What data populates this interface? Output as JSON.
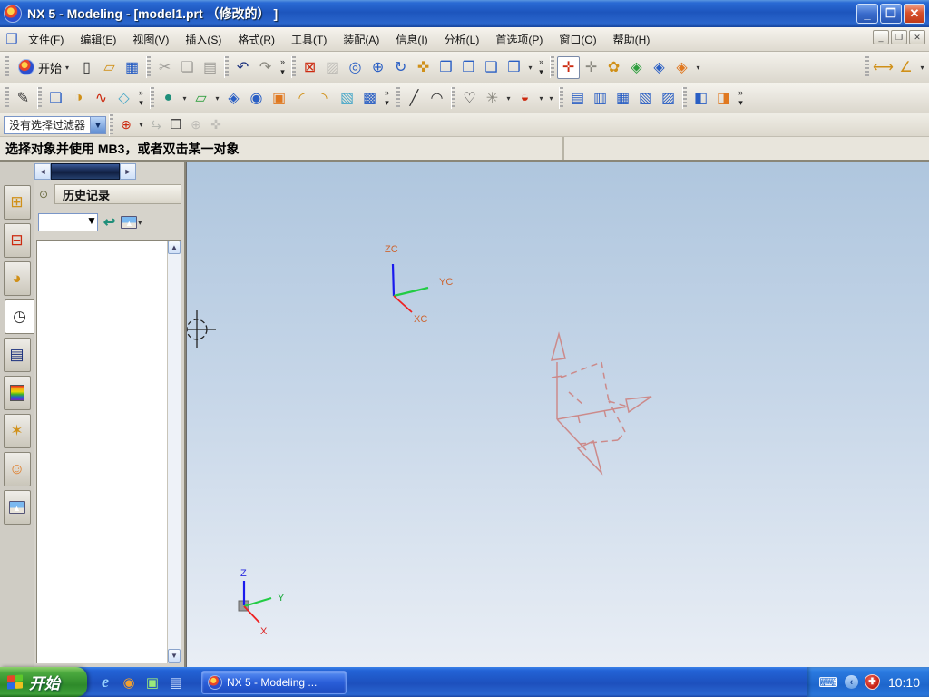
{
  "window": {
    "title": "NX 5 - Modeling - [model1.prt （修改的） ]",
    "minimize": "_",
    "restore": "❐",
    "close": "✕"
  },
  "menubar": {
    "items": [
      {
        "name": "menu-file",
        "label": "文件(F)"
      },
      {
        "name": "menu-edit",
        "label": "编辑(E)"
      },
      {
        "name": "menu-view",
        "label": "视图(V)"
      },
      {
        "name": "menu-insert",
        "label": "插入(S)"
      },
      {
        "name": "menu-format",
        "label": "格式(R)"
      },
      {
        "name": "menu-tools",
        "label": "工具(T)"
      },
      {
        "name": "menu-assemblies",
        "label": "装配(A)"
      },
      {
        "name": "menu-information",
        "label": "信息(I)"
      },
      {
        "name": "menu-analysis",
        "label": "分析(L)"
      },
      {
        "name": "menu-preferences",
        "label": "首选项(P)"
      },
      {
        "name": "menu-window",
        "label": "窗口(O)"
      },
      {
        "name": "menu-help",
        "label": "帮助(H)"
      }
    ],
    "minimize": "_",
    "restore": "❐",
    "close": "✕"
  },
  "toolbars": {
    "start_label": "开始",
    "start_caret": "▾",
    "row1_file": [
      {
        "name": "new-file-button",
        "glyph": "▯",
        "cls": "i-dark"
      },
      {
        "name": "open-file-button",
        "glyph": "▱",
        "cls": "i-gold"
      },
      {
        "name": "save-button",
        "glyph": "▦",
        "cls": "i-blue"
      }
    ],
    "row1_edit": [
      {
        "name": "cut-button",
        "glyph": "✂",
        "cls": "i-dark disabled"
      },
      {
        "name": "copy-button",
        "glyph": "❏",
        "cls": "i-dark disabled"
      },
      {
        "name": "paste-button",
        "glyph": "▤",
        "cls": "i-dark disabled"
      }
    ],
    "row1_hist": [
      {
        "name": "undo-button",
        "glyph": "↶",
        "cls": "i-dblue"
      },
      {
        "name": "redo-button",
        "glyph": "↷",
        "cls": "i-gray"
      },
      {
        "name": "toolbar-overflow",
        "glyph": "»\n▾",
        "cls": "overflow"
      }
    ],
    "row1_view": [
      {
        "name": "fit-view-button",
        "glyph": "⊠",
        "cls": "i-red"
      },
      {
        "name": "trim-view-button",
        "glyph": "▨",
        "cls": "i-gray disabled"
      },
      {
        "name": "zoom-box-button",
        "glyph": "◎",
        "cls": "i-blue"
      },
      {
        "name": "zoom-in-out-button",
        "glyph": "⊕",
        "cls": "i-blue"
      },
      {
        "name": "rotate-view-button",
        "glyph": "↻",
        "cls": "i-blue"
      },
      {
        "name": "pan-view-button",
        "glyph": "✜",
        "cls": "i-gold"
      },
      {
        "name": "perspective-button",
        "glyph": "❒",
        "cls": "i-blue"
      }
    ],
    "row1_assembly": [
      {
        "name": "assembly-constraints-button",
        "glyph": "❐",
        "cls": "i-blue"
      },
      {
        "name": "move-component-button",
        "glyph": "❑",
        "cls": "i-blue"
      }
    ],
    "row1_display": [
      {
        "name": "shaded-display-button",
        "glyph": "❒",
        "cls": "i-blue"
      },
      {
        "name": "display-dropdown-caret",
        "glyph": "▾",
        "cls": "caret"
      },
      {
        "name": "toolbar-overflow",
        "glyph": "»\n▾",
        "cls": "overflow"
      }
    ],
    "row1_wcs": [
      {
        "name": "wcs-dynamics-button",
        "glyph": "✛",
        "cls": "i-red pressed"
      },
      {
        "name": "wcs-origin-button",
        "glyph": "✛",
        "cls": "i-gray"
      },
      {
        "name": "object-display-button",
        "glyph": "✿",
        "cls": "i-gold"
      },
      {
        "name": "show-hide-button",
        "glyph": "◈",
        "cls": "i-green"
      },
      {
        "name": "invert-shown-button",
        "glyph": "◈",
        "cls": "i-blue"
      },
      {
        "name": "edit-display-button",
        "glyph": "◈",
        "cls": "i-orange"
      },
      {
        "name": "visibility-dropdown-caret",
        "glyph": "▾",
        "cls": "caret"
      }
    ],
    "row1_measure": [
      {
        "name": "measure-distance-button",
        "glyph": "⟷",
        "cls": "i-gold"
      },
      {
        "name": "measure-angle-button",
        "glyph": "∠",
        "cls": "i-gold"
      },
      {
        "name": "measure-dropdown-caret",
        "glyph": "▾",
        "cls": "caret"
      }
    ],
    "row2_sketch_task": [
      {
        "name": "sketch-in-task-button",
        "glyph": "✎",
        "cls": "i-dark"
      }
    ],
    "row2_solids": [
      {
        "name": "extrude-button",
        "glyph": "❏",
        "cls": "i-blue"
      },
      {
        "name": "revolve-button",
        "glyph": "◑",
        "cls": "i-gold"
      },
      {
        "name": "sweep-button",
        "glyph": "∿",
        "cls": "i-red"
      },
      {
        "name": "sheet-body-button",
        "glyph": "◇",
        "cls": "i-cyan"
      },
      {
        "name": "toolbar-overflow",
        "glyph": "»\n▾",
        "cls": "overflow"
      }
    ],
    "row2_sketch": [
      {
        "name": "sketch-button",
        "glyph": "●",
        "cls": "i-teal"
      },
      {
        "name": "sketch-dropdown-caret",
        "glyph": "▾",
        "cls": "caret"
      },
      {
        "name": "datum-plane-button",
        "glyph": "▱",
        "cls": "i-green"
      },
      {
        "name": "datum-plane-dropdown-caret",
        "glyph": "▾",
        "cls": "caret"
      }
    ],
    "row2_datum": [
      {
        "name": "datum-csys-button",
        "glyph": "◈",
        "cls": "i-blue"
      },
      {
        "name": "bounded-plane-button",
        "glyph": "◉",
        "cls": "i-blue"
      }
    ],
    "row2_features": [
      {
        "name": "block-button",
        "glyph": "▣",
        "cls": "i-orange"
      },
      {
        "name": "bend-button",
        "glyph": "◜",
        "cls": "i-gold"
      },
      {
        "name": "flange-button",
        "glyph": "◝",
        "cls": "i-gold"
      },
      {
        "name": "shell-button",
        "glyph": "▧",
        "cls": "i-cyan"
      },
      {
        "name": "boss-button",
        "glyph": "▩",
        "cls": "i-blue"
      },
      {
        "name": "toolbar-overflow",
        "glyph": "»\n▾",
        "cls": "overflow"
      }
    ],
    "row2_curves": [
      {
        "name": "line-button",
        "glyph": "╱",
        "cls": "i-dark"
      },
      {
        "name": "arc-button",
        "glyph": "◠",
        "cls": "i-dark"
      }
    ],
    "row2_profile": [
      {
        "name": "profile-curve-button",
        "glyph": "♡",
        "cls": "i-dark"
      },
      {
        "name": "point-set-button",
        "glyph": "✳",
        "cls": "i-gray"
      },
      {
        "name": "point-dropdown-caret",
        "glyph": "▾",
        "cls": "caret"
      },
      {
        "name": "offset-surface-button",
        "glyph": "◒",
        "cls": "i-red"
      },
      {
        "name": "surface-dropdown-caret",
        "glyph": "▾",
        "cls": "caret"
      },
      {
        "name": "toolbar-options-caret",
        "glyph": "▾",
        "cls": "caret"
      }
    ],
    "row2_mesh": [
      {
        "name": "ruled-surface-button",
        "glyph": "▤",
        "cls": "i-blue"
      },
      {
        "name": "through-curves-button",
        "glyph": "▥",
        "cls": "i-blue"
      },
      {
        "name": "through-curve-mesh-button",
        "glyph": "▦",
        "cls": "i-blue"
      },
      {
        "name": "swept-surface-button",
        "glyph": "▧",
        "cls": "i-blue"
      },
      {
        "name": "section-surface-button",
        "glyph": "▨",
        "cls": "i-blue"
      }
    ],
    "row2_surface": [
      {
        "name": "studio-surface-button",
        "glyph": "◧",
        "cls": "i-blue"
      },
      {
        "name": "bounded-surface-button",
        "glyph": "◨",
        "cls": "i-orange"
      },
      {
        "name": "toolbar-overflow",
        "glyph": "»\n▾",
        "cls": "overflow"
      }
    ]
  },
  "filterbar": {
    "filter_value": "没有选择过滤器",
    "combo_caret": "▼",
    "icons": [
      {
        "name": "selection-filter-button",
        "glyph": "⊕",
        "cls": "i-red"
      },
      {
        "name": "filter-dropdown-caret",
        "glyph": "▾",
        "cls": "caret"
      },
      {
        "name": "swap-selection-button",
        "glyph": "⇆",
        "cls": "i-teal disabled"
      },
      {
        "name": "snapshot-button",
        "glyph": "❒",
        "cls": "i-dark"
      },
      {
        "name": "deselect-button",
        "glyph": "⊕",
        "cls": "i-gray disabled"
      },
      {
        "name": "grab-button",
        "glyph": "✜",
        "cls": "i-gray disabled"
      }
    ]
  },
  "prompt": {
    "text": "选择对象并使用 MB3，或者双击某一对象"
  },
  "resource": {
    "hscroll_left": "◄",
    "hscroll_right": "►",
    "tabs": [
      {
        "name": "tab-assembly-navigator",
        "glyph": "⊞",
        "cls": "i-gold"
      },
      {
        "name": "tab-constraint-navigator",
        "glyph": "⊟",
        "cls": "i-red"
      },
      {
        "name": "tab-part-navigator",
        "glyph": "◕",
        "cls": "i-gold"
      },
      {
        "name": "tab-history",
        "glyph": "◷",
        "cls": "i-dark active"
      },
      {
        "name": "tab-catalog",
        "glyph": "▤",
        "cls": "i-dblue"
      },
      {
        "name": "tab-materials",
        "glyph": "▮",
        "cls": "g-rainbow-cell"
      },
      {
        "name": "tab-visualization",
        "glyph": "✶",
        "cls": "i-gold"
      },
      {
        "name": "tab-roles",
        "glyph": "☺",
        "cls": "i-orange"
      },
      {
        "name": "tab-scenes",
        "glyph": "▲",
        "cls": "g-scene-cell"
      }
    ],
    "panel": {
      "title": "历史记录",
      "pin": "⊙",
      "combo_value": "",
      "combo_caret": "▼",
      "return_glyph": "↩",
      "img_caret": "▾",
      "vscroll_up": "▲",
      "vscroll_down": "▼"
    }
  },
  "viewport": {
    "wcs_labels": {
      "z": "ZC",
      "y": "YC",
      "x": "XC"
    },
    "triad_labels": {
      "z": "Z",
      "y": "Y",
      "x": "X"
    },
    "colors": {
      "axis_z": "#1a1aee",
      "axis_y": "#22cc44",
      "axis_x": "#ee2222",
      "wcs_label": "#cc6633",
      "ghost": "#cc8a8a"
    }
  },
  "taskbar": {
    "start_label": "开始",
    "task_label": "NX 5 - Modeling ...",
    "clock": "10:10",
    "quick_launch": [
      {
        "name": "ie-icon",
        "glyph": "e",
        "cls": "ql-ie"
      },
      {
        "name": "media-player-icon",
        "glyph": "◉",
        "cls": "ql-media"
      },
      {
        "name": "show-desktop-icon",
        "glyph": "▣",
        "cls": "ql-desk"
      },
      {
        "name": "messenger-icon",
        "glyph": "▤",
        "cls": "ql-msg"
      }
    ],
    "tray_keyboard": "⌨",
    "tray_chevron": "‹",
    "tray_shield": "✚"
  }
}
